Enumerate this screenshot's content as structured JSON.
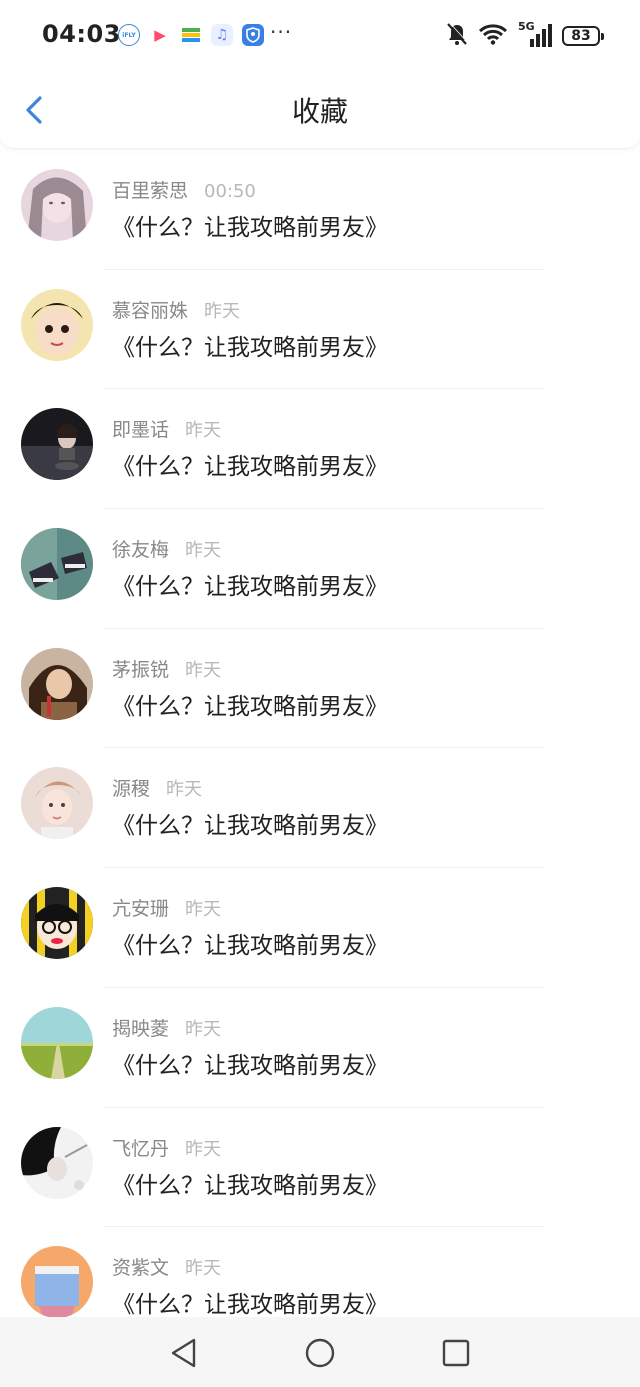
{
  "status_bar": {
    "time": "04:03",
    "ifly_label": "iFLY",
    "network": "5G",
    "battery": "83",
    "more": "···"
  },
  "header": {
    "title": "收藏",
    "back_icon": "chevron-left-icon"
  },
  "items": [
    {
      "name": "百里萦思",
      "time": "00:50",
      "title": "《什么？让我攻略前男友》"
    },
    {
      "name": "慕容丽姝",
      "time": "昨天",
      "title": "《什么？让我攻略前男友》"
    },
    {
      "name": "即墨话",
      "time": "昨天",
      "title": "《什么？让我攻略前男友》"
    },
    {
      "name": "徐友梅",
      "time": "昨天",
      "title": "《什么？让我攻略前男友》"
    },
    {
      "name": "茅振锐",
      "time": "昨天",
      "title": "《什么？让我攻略前男友》"
    },
    {
      "name": "源稷",
      "time": "昨天",
      "title": "《什么？让我攻略前男友》"
    },
    {
      "name": "亢安珊",
      "time": "昨天",
      "title": "《什么？让我攻略前男友》"
    },
    {
      "name": "揭映菱",
      "time": "昨天",
      "title": "《什么？让我攻略前男友》"
    },
    {
      "name": "飞忆丹",
      "time": "昨天",
      "title": "《什么？让我攻略前男友》"
    },
    {
      "name": "资紫文",
      "time": "昨天",
      "title": "《什么？让我攻略前男友》"
    }
  ],
  "colors": {
    "accent": "#3a86d9",
    "text_primary": "#222222",
    "text_secondary": "#888888",
    "text_time": "#b8b8b8"
  }
}
